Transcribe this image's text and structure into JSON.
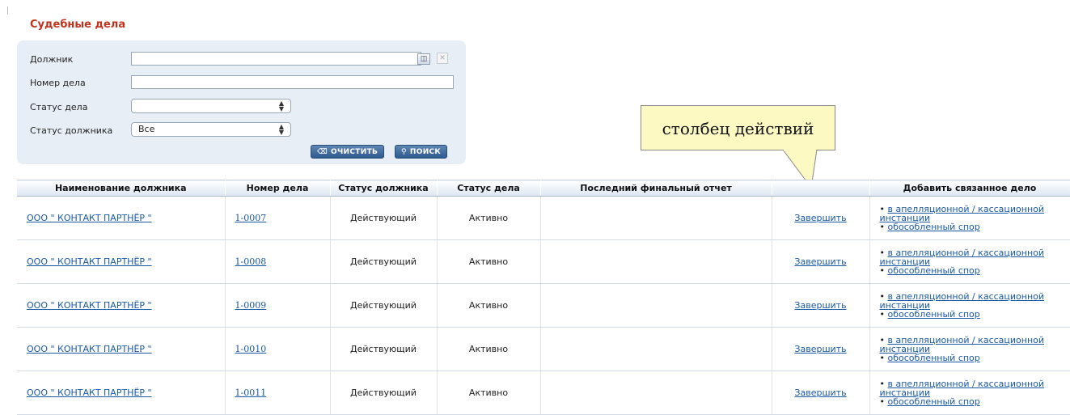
{
  "page": {
    "title": "Судебные дела"
  },
  "filters": {
    "debtor_label": "Должник",
    "case_number_label": "Номер дела",
    "case_status_label": "Статус дела",
    "case_status_value": "",
    "debtor_status_label": "Статус должника",
    "debtor_status_value": "Все",
    "clear_label": "ОЧИСТИТЬ",
    "search_label": "ПОИСК"
  },
  "callout": {
    "text": "столбец действий"
  },
  "table": {
    "headers": [
      "Наименование должника",
      "Номер дела",
      "Статус должника",
      "Статус дела",
      "Последний финальный отчет",
      "",
      "Добавить связанное дело"
    ],
    "rows": [
      {
        "debtor": "ООО \" КОНТАКТ ПАРТНЁР \"",
        "case_number": "1-0007",
        "debtor_status": "Действующий",
        "case_status": "Активно",
        "last_report": "",
        "action": "Завершить",
        "related_appeal": "в апелляционной / кассационной",
        "related_appeal_2": "инстанции",
        "related_dispute": "обособленный спор"
      },
      {
        "debtor": "ООО \" КОНТАКТ ПАРТНЁР \"",
        "case_number": "1-0008",
        "debtor_status": "Действующий",
        "case_status": "Активно",
        "last_report": "",
        "action": "Завершить",
        "related_appeal": "в апелляционной / кассационной",
        "related_appeal_2": "инстанции",
        "related_dispute": "обособленный спор"
      },
      {
        "debtor": "ООО \" КОНТАКТ ПАРТНЁР \"",
        "case_number": "1-0009",
        "debtor_status": "Действующий",
        "case_status": "Активно",
        "last_report": "",
        "action": "Завершить",
        "related_appeal": "в апелляционной / кассационной",
        "related_appeal_2": "инстанции",
        "related_dispute": "обособленный спор"
      },
      {
        "debtor": "ООО \" КОНТАКТ ПАРТНЁР \"",
        "case_number": "1-0010",
        "debtor_status": "Действующий",
        "case_status": "Активно",
        "last_report": "",
        "action": "Завершить",
        "related_appeal": "в апелляционной / кассационной",
        "related_appeal_2": "инстанции",
        "related_dispute": "обособленный спор"
      },
      {
        "debtor": "ООО \" КОНТАКТ ПАРТНЁР \"",
        "case_number": "1-0011",
        "debtor_status": "Действующий",
        "case_status": "Активно",
        "last_report": "",
        "action": "Завершить",
        "related_appeal": "в апелляционной / кассационной",
        "related_appeal_2": "инстанции",
        "related_dispute": "обособленный спор"
      }
    ]
  },
  "icons": {
    "pick": "lookup-icon",
    "clear": "clear-x-icon",
    "eraser": "eraser-icon",
    "search": "search-icon",
    "select_arrows": "updown-arrows-icon"
  },
  "colors": {
    "title": "#c4311b",
    "link": "#1a5aa8",
    "panel": "#e8eef6",
    "button": "#2e5a8e",
    "callout": "#fdf9c3"
  }
}
